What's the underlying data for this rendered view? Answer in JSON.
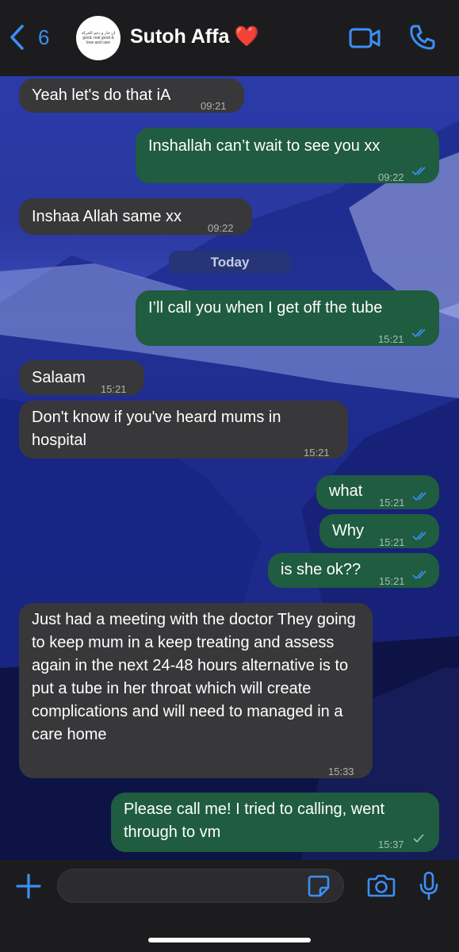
{
  "header": {
    "back_count": "6",
    "contact_name": "Sutoh Affa",
    "contact_emoji": "❤️",
    "avatar_text": "ان جار و دعم الحركة good, real good & love and care",
    "accent_color": "#3b8ff5"
  },
  "date_separator": "Today",
  "messages": [
    {
      "direction": "incoming",
      "text": "Yeah let's do that iA",
      "time": "09:21"
    },
    {
      "direction": "outgoing",
      "text": "Inshallah can’t wait to see you xx",
      "time": "09:22",
      "status": "read"
    },
    {
      "direction": "incoming",
      "text": "Inshaa Allah same xx",
      "time": "09:22"
    },
    {
      "direction": "outgoing",
      "text": "I’ll call you when I get off the tube",
      "time": "15:21",
      "status": "read"
    },
    {
      "direction": "incoming",
      "text": "Salaam",
      "time": "15:21"
    },
    {
      "direction": "incoming",
      "text": "Don't know if you've heard mums in hospital",
      "time": "15:21"
    },
    {
      "direction": "outgoing",
      "text": "what",
      "time": "15:21",
      "status": "read"
    },
    {
      "direction": "outgoing",
      "text": "Why",
      "time": "15:21",
      "status": "read"
    },
    {
      "direction": "outgoing",
      "text": "is she ok??",
      "time": "15:21",
      "status": "read"
    },
    {
      "direction": "incoming",
      "text": "Just had a meeting with the doctor They going to keep mum in a keep treating and assess again in the next 24-48 hours alternative is to put a tube in her throat which will create complications and will need to managed in a care home",
      "time": "15:33"
    },
    {
      "direction": "outgoing",
      "text": "Please call me! I tried to calling, went through to vm",
      "time": "15:37",
      "status": "delivered"
    }
  ],
  "composer": {
    "value": "",
    "placeholder": ""
  },
  "icons": [
    "back-chevron-icon",
    "video-call-icon",
    "phone-call-icon",
    "plus-icon",
    "sticker-icon",
    "camera-icon",
    "microphone-icon"
  ]
}
